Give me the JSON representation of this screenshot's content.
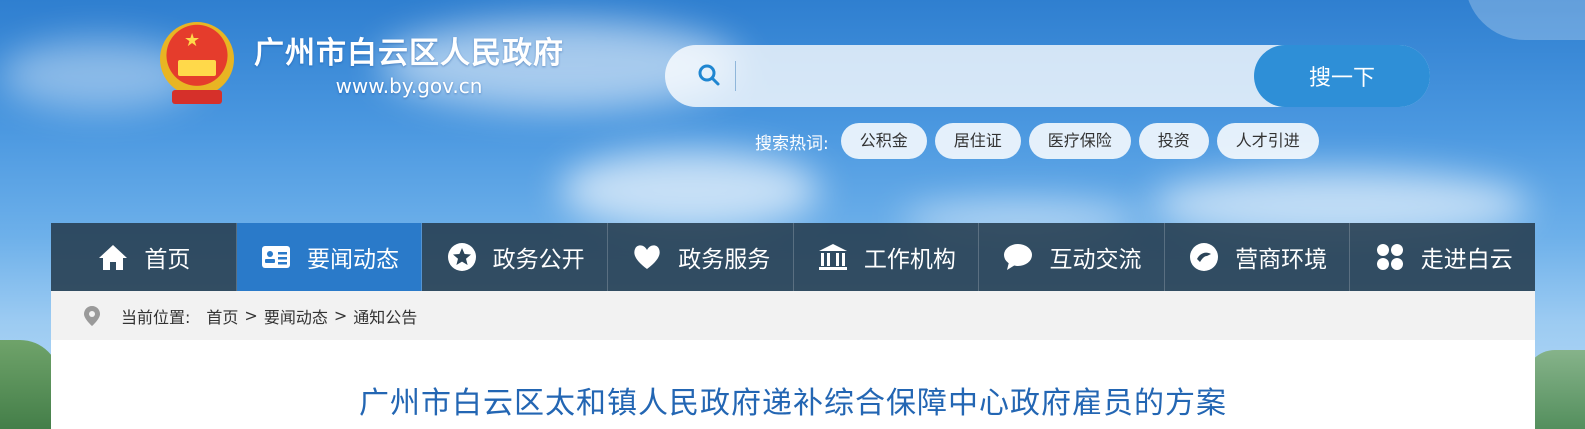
{
  "site": {
    "name": "广州市白云区人民政府",
    "url": "www.by.gov.cn"
  },
  "search": {
    "placeholder": "",
    "button_label": "搜一下",
    "hot_label": "搜索热词:",
    "hot_tags": [
      "公积金",
      "居住证",
      "医疗保险",
      "投资",
      "人才引进"
    ]
  },
  "nav": {
    "items": [
      {
        "label": "首页",
        "icon": "home-icon"
      },
      {
        "label": "要闻动态",
        "icon": "news-card-icon"
      },
      {
        "label": "政务公开",
        "icon": "star-badge-icon"
      },
      {
        "label": "政务服务",
        "icon": "heart-icon"
      },
      {
        "label": "工作机构",
        "icon": "building-icon"
      },
      {
        "label": "互动交流",
        "icon": "chat-bubble-icon"
      },
      {
        "label": "营商环境",
        "icon": "handshake-icon"
      },
      {
        "label": "走进白云",
        "icon": "grid-icon"
      }
    ],
    "active_index": 1,
    "active_color": "#2a7ac9"
  },
  "breadcrumb": {
    "label": "当前位置:",
    "items": [
      "首页",
      "要闻动态",
      "通知公告"
    ],
    "separator": ">"
  },
  "article": {
    "title": "广州市白云区太和镇人民政府递补综合保障中心政府雇员的方案"
  }
}
